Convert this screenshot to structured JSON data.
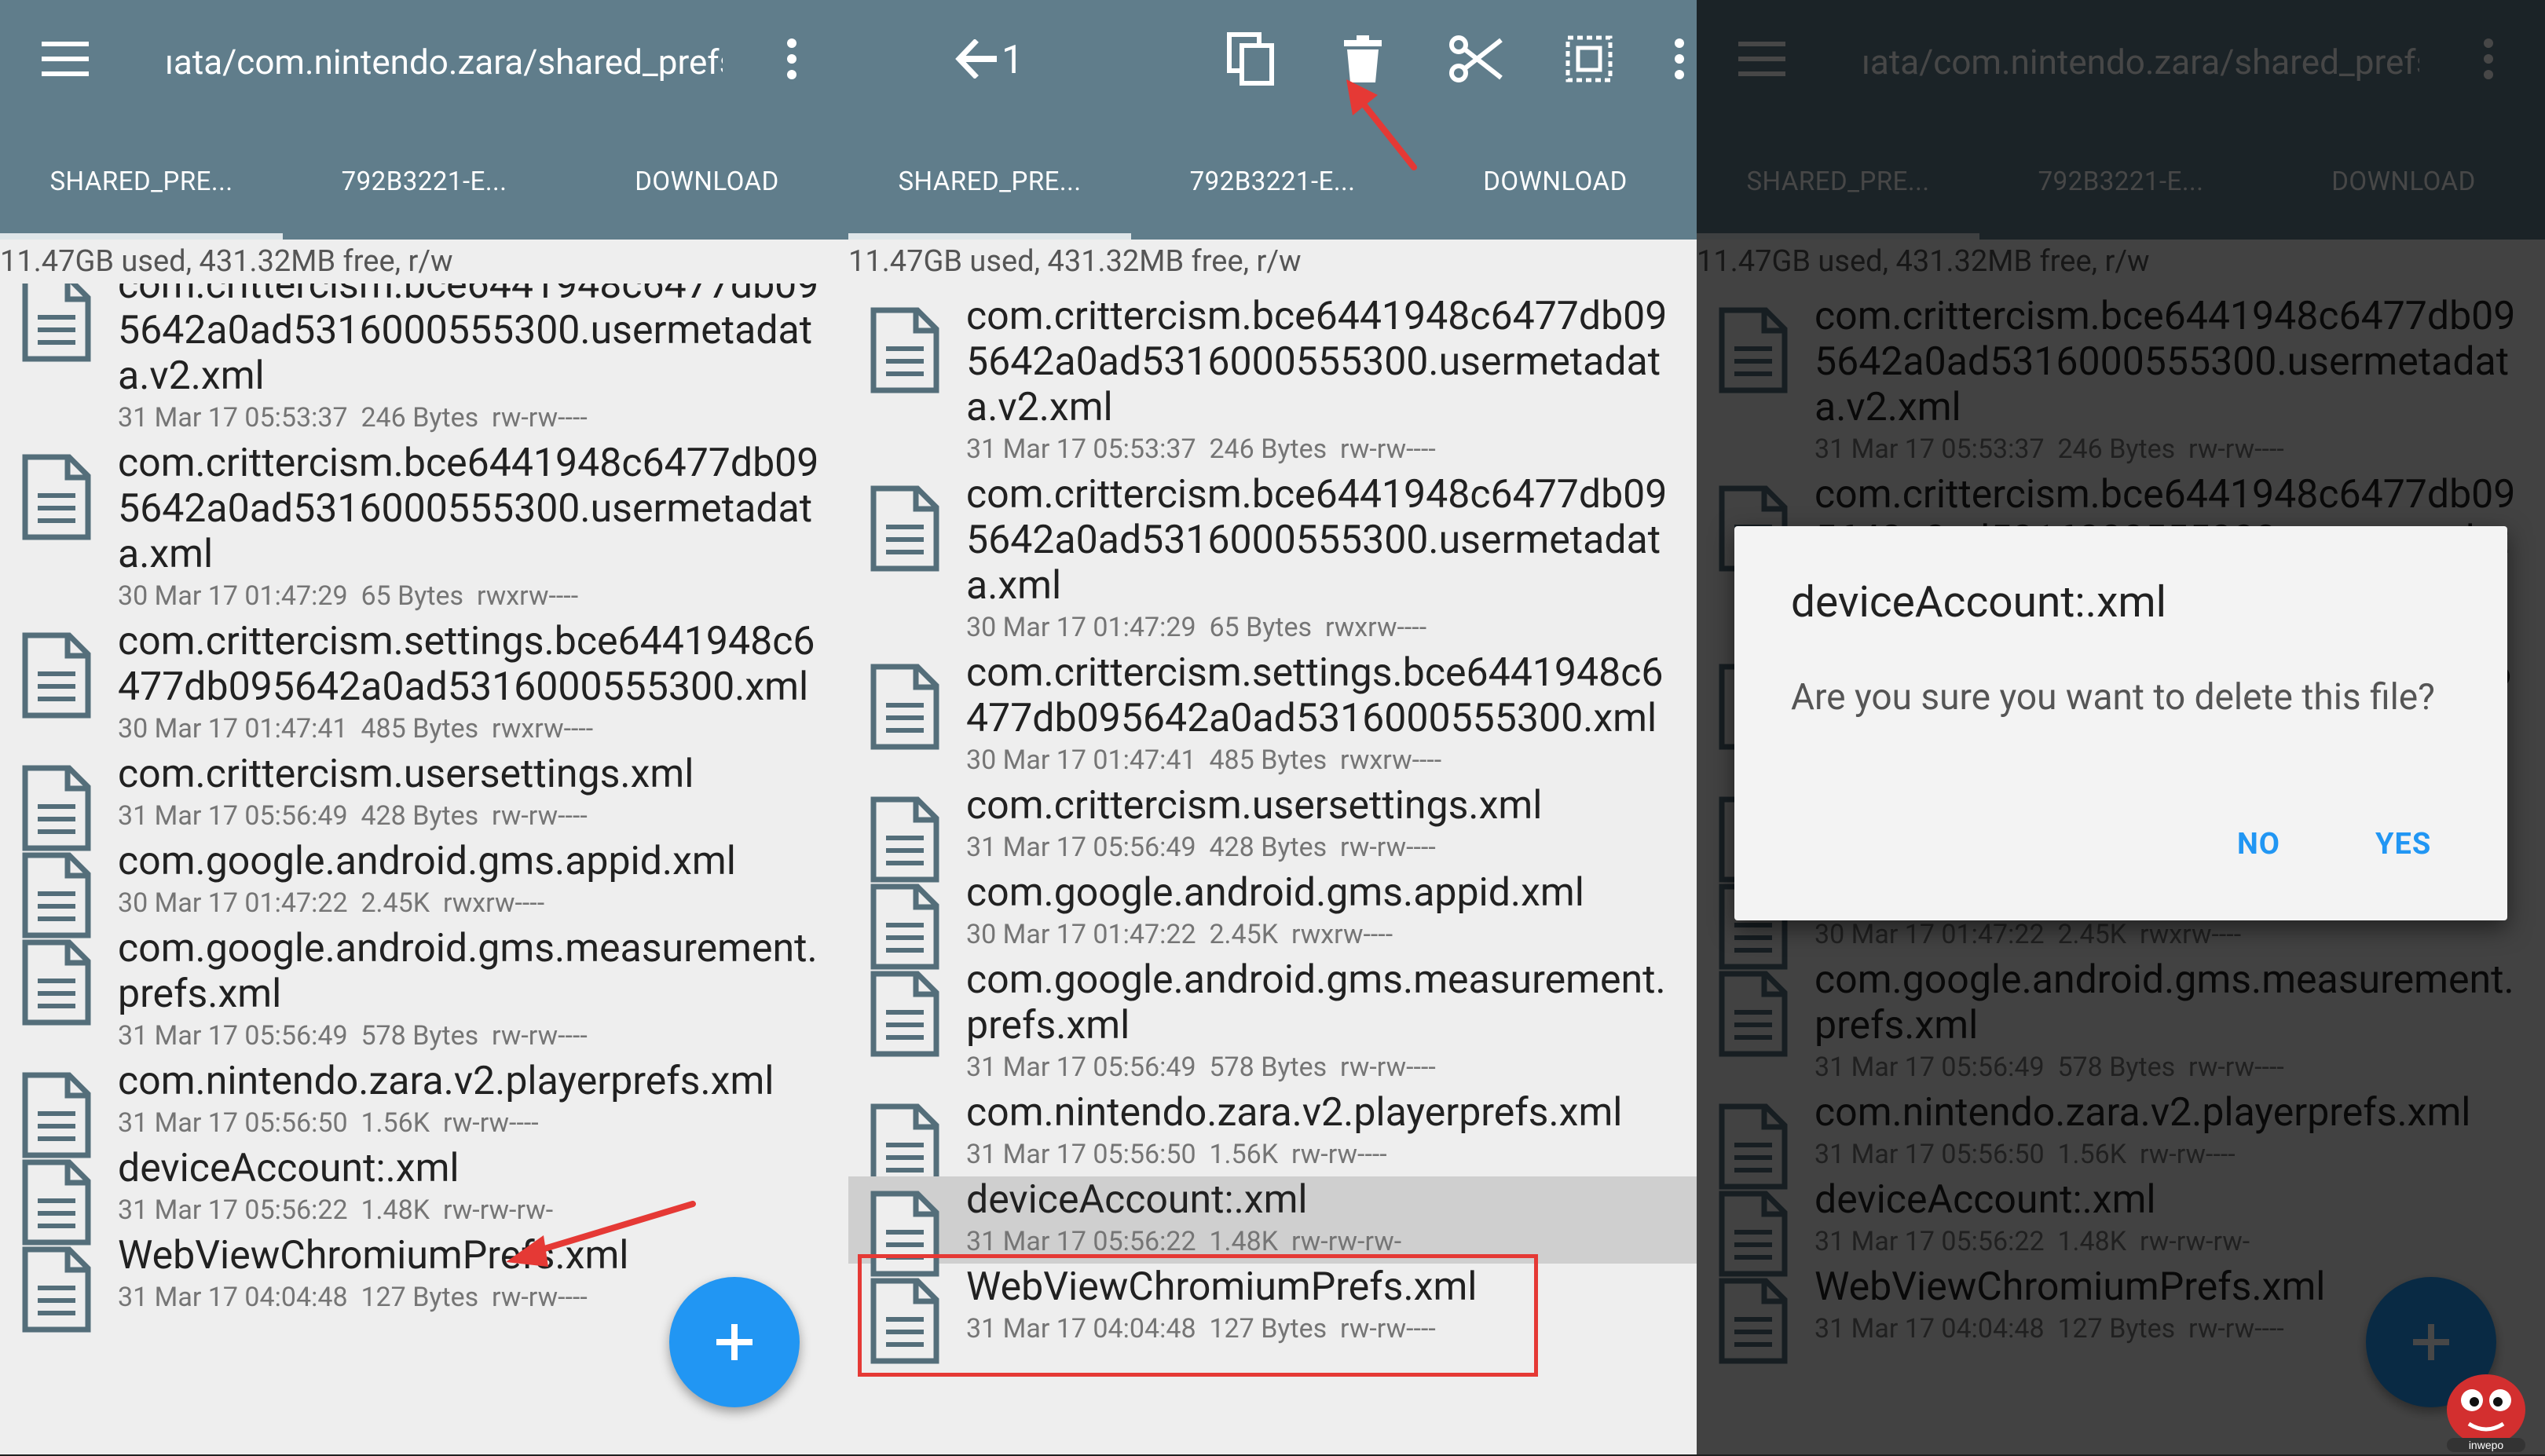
{
  "app": {
    "path": "ıata/com.nintendo.zara/shared_prefs",
    "selection_count": "1",
    "storage": "11.47GB used, 431.32MB free, r/w",
    "tabs": [
      "SHARED_PRE...",
      "792B3221-E...",
      "DOWNLOAD"
    ]
  },
  "files": [
    {
      "name": "com.crittercism.bce6441948c6477db095642a0ad5316000555300.usermetadata.v2.xml",
      "date": "31 Mar 17 05:53:37",
      "size": "246 Bytes",
      "perms": "rw-rw----"
    },
    {
      "name": "com.crittercism.bce6441948c6477db095642a0ad5316000555300.usermetadata.xml",
      "date": "30 Mar 17 01:47:29",
      "size": "65 Bytes",
      "perms": "rwxrw----"
    },
    {
      "name": "com.crittercism.settings.bce6441948c6477db095642a0ad5316000555300.xml",
      "date": "30 Mar 17 01:47:41",
      "size": "485 Bytes",
      "perms": "rwxrw----"
    },
    {
      "name": "com.crittercism.usersettings.xml",
      "date": "31 Mar 17 05:56:49",
      "size": "428 Bytes",
      "perms": "rw-rw----"
    },
    {
      "name": "com.google.android.gms.appid.xml",
      "date": "30 Mar 17 01:47:22",
      "size": "2.45K",
      "perms": "rwxrw----"
    },
    {
      "name": "com.google.android.gms.measurement.prefs.xml",
      "date": "31 Mar 17 05:56:49",
      "size": "578 Bytes",
      "perms": "rw-rw----"
    },
    {
      "name": "com.nintendo.zara.v2.playerprefs.xml",
      "date": "31 Mar 17 05:56:50",
      "size": "1.56K",
      "perms": "rw-rw----"
    },
    {
      "name": "deviceAccount:.xml",
      "date": "31 Mar 17 05:56:22",
      "size": "1.48K",
      "perms": "rw-rw-rw-"
    },
    {
      "name": "WebViewChromiumPrefs.xml",
      "date": "31 Mar 17 04:04:48",
      "size": "127 Bytes",
      "perms": "rw-rw----"
    }
  ],
  "dialog": {
    "title": "deviceAccount:.xml",
    "message": "Are you sure you want to delete this file?",
    "no_label": "NO",
    "yes_label": "YES"
  },
  "fab_label": "+",
  "watermark": "inwepo",
  "colors": {
    "appbar": "#607d8b",
    "accent": "#2196f3",
    "annotation": "#e53935"
  }
}
